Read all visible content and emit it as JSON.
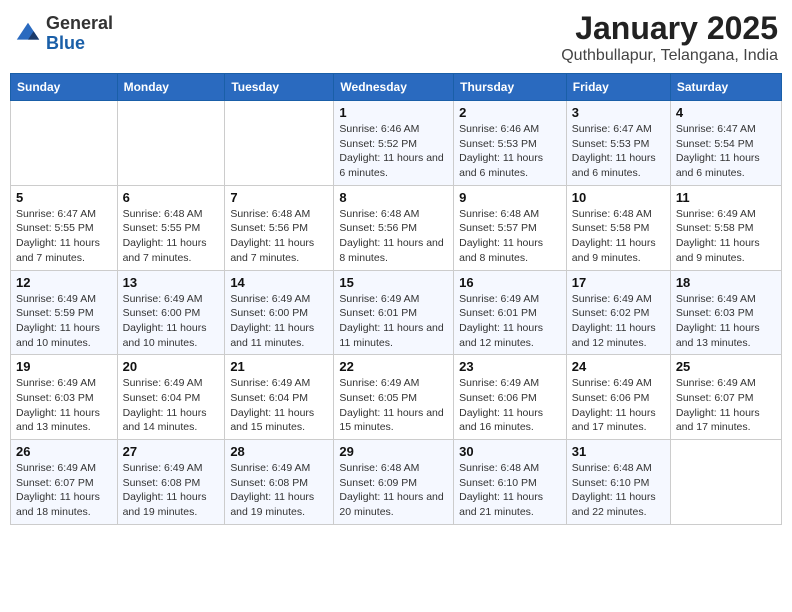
{
  "header": {
    "logo_general": "General",
    "logo_blue": "Blue",
    "title": "January 2025",
    "subtitle": "Quthbullapur, Telangana, India"
  },
  "days_of_week": [
    "Sunday",
    "Monday",
    "Tuesday",
    "Wednesday",
    "Thursday",
    "Friday",
    "Saturday"
  ],
  "weeks": [
    [
      {
        "day": "",
        "info": ""
      },
      {
        "day": "",
        "info": ""
      },
      {
        "day": "",
        "info": ""
      },
      {
        "day": "1",
        "info": "Sunrise: 6:46 AM\nSunset: 5:52 PM\nDaylight: 11 hours and 6 minutes."
      },
      {
        "day": "2",
        "info": "Sunrise: 6:46 AM\nSunset: 5:53 PM\nDaylight: 11 hours and 6 minutes."
      },
      {
        "day": "3",
        "info": "Sunrise: 6:47 AM\nSunset: 5:53 PM\nDaylight: 11 hours and 6 minutes."
      },
      {
        "day": "4",
        "info": "Sunrise: 6:47 AM\nSunset: 5:54 PM\nDaylight: 11 hours and 6 minutes."
      }
    ],
    [
      {
        "day": "5",
        "info": "Sunrise: 6:47 AM\nSunset: 5:55 PM\nDaylight: 11 hours and 7 minutes."
      },
      {
        "day": "6",
        "info": "Sunrise: 6:48 AM\nSunset: 5:55 PM\nDaylight: 11 hours and 7 minutes."
      },
      {
        "day": "7",
        "info": "Sunrise: 6:48 AM\nSunset: 5:56 PM\nDaylight: 11 hours and 7 minutes."
      },
      {
        "day": "8",
        "info": "Sunrise: 6:48 AM\nSunset: 5:56 PM\nDaylight: 11 hours and 8 minutes."
      },
      {
        "day": "9",
        "info": "Sunrise: 6:48 AM\nSunset: 5:57 PM\nDaylight: 11 hours and 8 minutes."
      },
      {
        "day": "10",
        "info": "Sunrise: 6:48 AM\nSunset: 5:58 PM\nDaylight: 11 hours and 9 minutes."
      },
      {
        "day": "11",
        "info": "Sunrise: 6:49 AM\nSunset: 5:58 PM\nDaylight: 11 hours and 9 minutes."
      }
    ],
    [
      {
        "day": "12",
        "info": "Sunrise: 6:49 AM\nSunset: 5:59 PM\nDaylight: 11 hours and 10 minutes."
      },
      {
        "day": "13",
        "info": "Sunrise: 6:49 AM\nSunset: 6:00 PM\nDaylight: 11 hours and 10 minutes."
      },
      {
        "day": "14",
        "info": "Sunrise: 6:49 AM\nSunset: 6:00 PM\nDaylight: 11 hours and 11 minutes."
      },
      {
        "day": "15",
        "info": "Sunrise: 6:49 AM\nSunset: 6:01 PM\nDaylight: 11 hours and 11 minutes."
      },
      {
        "day": "16",
        "info": "Sunrise: 6:49 AM\nSunset: 6:01 PM\nDaylight: 11 hours and 12 minutes."
      },
      {
        "day": "17",
        "info": "Sunrise: 6:49 AM\nSunset: 6:02 PM\nDaylight: 11 hours and 12 minutes."
      },
      {
        "day": "18",
        "info": "Sunrise: 6:49 AM\nSunset: 6:03 PM\nDaylight: 11 hours and 13 minutes."
      }
    ],
    [
      {
        "day": "19",
        "info": "Sunrise: 6:49 AM\nSunset: 6:03 PM\nDaylight: 11 hours and 13 minutes."
      },
      {
        "day": "20",
        "info": "Sunrise: 6:49 AM\nSunset: 6:04 PM\nDaylight: 11 hours and 14 minutes."
      },
      {
        "day": "21",
        "info": "Sunrise: 6:49 AM\nSunset: 6:04 PM\nDaylight: 11 hours and 15 minutes."
      },
      {
        "day": "22",
        "info": "Sunrise: 6:49 AM\nSunset: 6:05 PM\nDaylight: 11 hours and 15 minutes."
      },
      {
        "day": "23",
        "info": "Sunrise: 6:49 AM\nSunset: 6:06 PM\nDaylight: 11 hours and 16 minutes."
      },
      {
        "day": "24",
        "info": "Sunrise: 6:49 AM\nSunset: 6:06 PM\nDaylight: 11 hours and 17 minutes."
      },
      {
        "day": "25",
        "info": "Sunrise: 6:49 AM\nSunset: 6:07 PM\nDaylight: 11 hours and 17 minutes."
      }
    ],
    [
      {
        "day": "26",
        "info": "Sunrise: 6:49 AM\nSunset: 6:07 PM\nDaylight: 11 hours and 18 minutes."
      },
      {
        "day": "27",
        "info": "Sunrise: 6:49 AM\nSunset: 6:08 PM\nDaylight: 11 hours and 19 minutes."
      },
      {
        "day": "28",
        "info": "Sunrise: 6:49 AM\nSunset: 6:08 PM\nDaylight: 11 hours and 19 minutes."
      },
      {
        "day": "29",
        "info": "Sunrise: 6:48 AM\nSunset: 6:09 PM\nDaylight: 11 hours and 20 minutes."
      },
      {
        "day": "30",
        "info": "Sunrise: 6:48 AM\nSunset: 6:10 PM\nDaylight: 11 hours and 21 minutes."
      },
      {
        "day": "31",
        "info": "Sunrise: 6:48 AM\nSunset: 6:10 PM\nDaylight: 11 hours and 22 minutes."
      },
      {
        "day": "",
        "info": ""
      }
    ]
  ]
}
